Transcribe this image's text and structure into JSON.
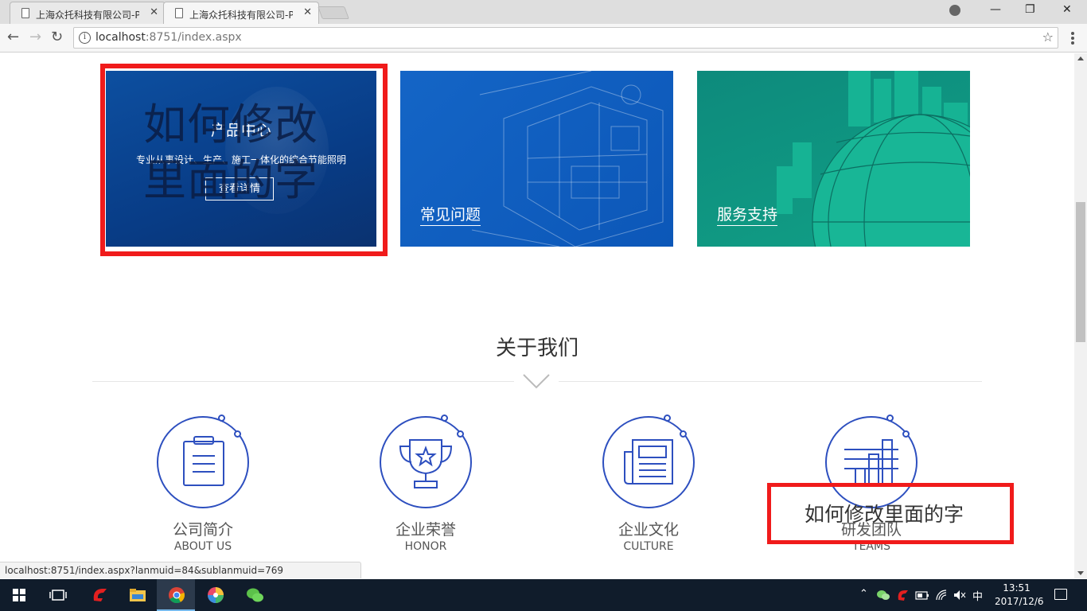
{
  "browser": {
    "tabs": [
      {
        "title": "上海众托科技有限公司-P",
        "active": false
      },
      {
        "title": "上海众托科技有限公司-P",
        "active": true
      }
    ],
    "tab_close_glyph": "✕",
    "url_host": "localhost",
    "url_rest": ":8751/index.aspx",
    "window_controls": {
      "minimize": "—",
      "restore": "❐",
      "close": "✕"
    },
    "nav": {
      "back": "←",
      "forward": "→",
      "reload": "↻"
    },
    "info_glyph": "i",
    "star_glyph": "☆"
  },
  "cards": [
    {
      "title": "产品中心",
      "description": "专业从事设计、生产、施工一体化的综合节能照明",
      "button": "查看详情",
      "color": "#0a4590"
    },
    {
      "title": "常见问题",
      "color": "#0c5bbd"
    },
    {
      "title": "服务支持",
      "color": "#0f9280"
    }
  ],
  "overlay_annotations": {
    "large_text": "如何修改里面的字",
    "small_text": "如何修改里面的字",
    "box_color": "#f01b1b"
  },
  "about": {
    "title": "关于我们",
    "items": [
      {
        "zh": "公司简介",
        "en": "ABOUT  US",
        "icon": "clipboard-icon"
      },
      {
        "zh": "企业荣誉",
        "en": "HONOR",
        "icon": "trophy-icon"
      },
      {
        "zh": "企业文化",
        "en": "CULTURE",
        "icon": "newspaper-icon"
      },
      {
        "zh": "研发团队",
        "en": "TEAMS",
        "icon": "bar-chart-icon"
      }
    ],
    "accent_color": "#2d4fbf"
  },
  "status_url": "localhost:8751/index.aspx?lanmuid=84&sublanmuid=769",
  "taskbar": {
    "ime": "中",
    "time": "13:51",
    "date": "2017/12/6"
  }
}
